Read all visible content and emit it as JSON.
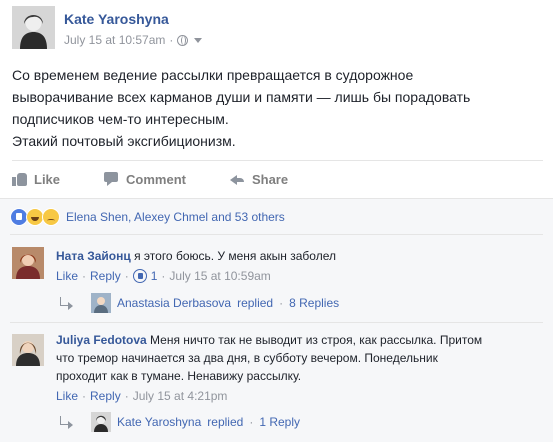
{
  "post": {
    "author": "Kate Yaroshyna",
    "timestamp": "July 15 at 10:57am",
    "separator": "·",
    "text_lines": [
      "Со временем ведение рассылки превращается в судорожное",
      "выворачивание всех карманов души и памяти — лишь бы порадовать",
      "подписчиков чем-то интересным.",
      "Этакий почтовый эксгибиционизм."
    ],
    "audience_icon": "globe-icon",
    "menu_icon": "chevron-down-icon"
  },
  "actions": {
    "like": "Like",
    "comment": "Comment",
    "share": "Share"
  },
  "reactions": {
    "icons": [
      "like-reaction-icon",
      "haha-reaction-icon",
      "sad-reaction-icon"
    ],
    "summary": "Elena Shen, Alexey Chmel and 53 others"
  },
  "comments": [
    {
      "author": "Ната Зайонц",
      "text": "я этого боюсь. У меня акын заболел",
      "like": "Like",
      "reply": "Reply",
      "likes_count": "1",
      "time": "July 15 at 10:59am",
      "replies": {
        "author": "Anastasia Derbasova",
        "action": "replied",
        "count": "8 Replies"
      }
    },
    {
      "author": "Juliya Fedotova",
      "text_lines": [
        "Меня ничто так не выводит из строя, как рассылка. Притом",
        "что тремор начинается за два дня, в субботу вечером. Понедельник",
        "проходит как в тумане. Ненавижу рассылку."
      ],
      "like": "Like",
      "reply": "Reply",
      "time": "July 15 at 4:21pm",
      "replies": {
        "author": "Kate Yaroshyna",
        "action": "replied",
        "count": "1 Reply"
      }
    }
  ],
  "colors": {
    "link": "#4267b2",
    "name": "#365899",
    "muted": "#90949c",
    "background_gray": "#f6f7f9"
  }
}
